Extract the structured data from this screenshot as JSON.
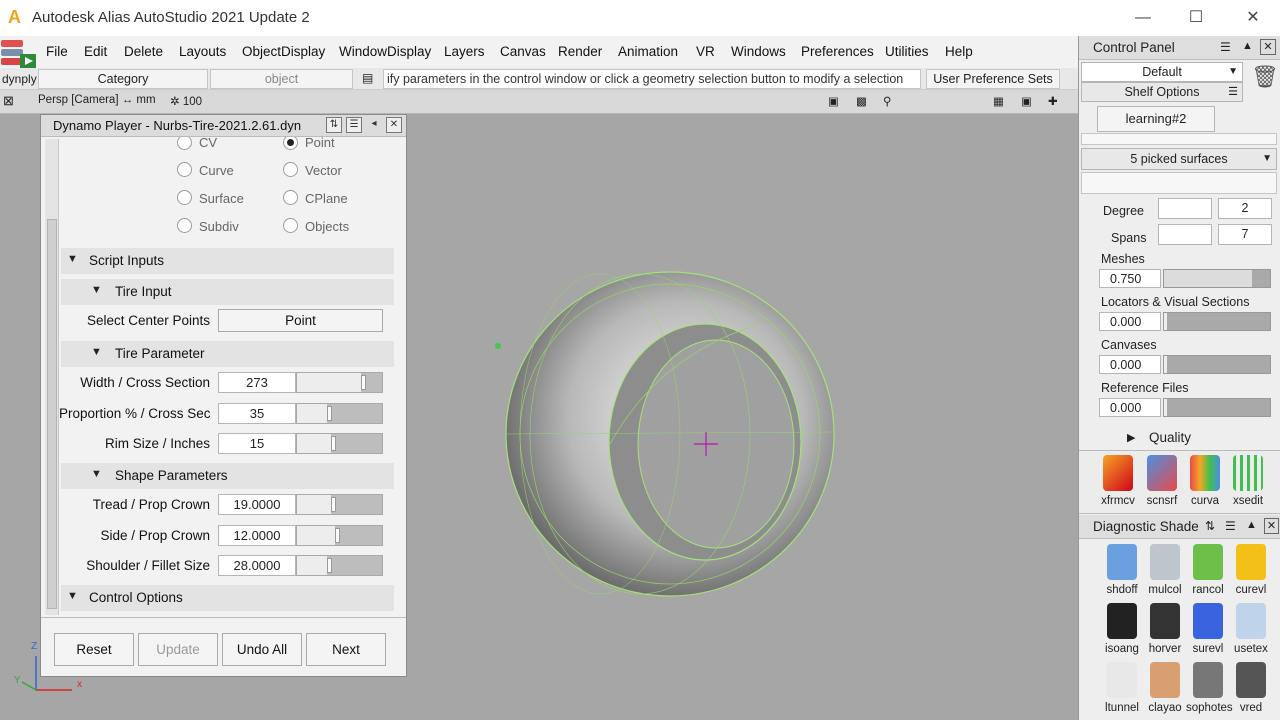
{
  "window": {
    "title": "Autodesk Alias AutoStudio 2021 Update 2",
    "app_icon_letter": "A"
  },
  "menubar": [
    "File",
    "Edit",
    "Delete",
    "Layouts",
    "ObjectDisplay",
    "WindowDisplay",
    "Layers",
    "Canvas",
    "Render",
    "Animation",
    "VR",
    "Windows",
    "Preferences",
    "Utilities",
    "Help"
  ],
  "toolbar2": {
    "dynply": "dynply",
    "category": "Category",
    "object": "object",
    "prompt": "ify parameters in the control window or click a geometry selection button to modify a selection",
    "user_pref": "User Preference Sets"
  },
  "viewport": {
    "camera": "Persp [Camera] ↔ mm",
    "zoom": "✲ 100",
    "axis_x": "x",
    "axis_y": "Y",
    "axis_z": "Z"
  },
  "dynamo": {
    "title": "Dynamo Player - Nurbs-Tire-2021.2.61.dyn",
    "radios": [
      {
        "label": "CV",
        "checked": false
      },
      {
        "label": "Point",
        "checked": true
      },
      {
        "label": "Curve",
        "checked": false
      },
      {
        "label": "Vector",
        "checked": false
      },
      {
        "label": "Surface",
        "checked": false
      },
      {
        "label": "CPlane",
        "checked": false
      },
      {
        "label": "Subdiv",
        "checked": false
      },
      {
        "label": "Objects",
        "checked": false
      }
    ],
    "script_inputs": "Script Inputs",
    "tire_input": "Tire Input",
    "select_center_label": "Select Center Points",
    "select_center_button": "Point",
    "tire_parameter": "Tire Parameter",
    "tire_params": [
      {
        "label": "Width / Cross Section",
        "value": "273",
        "level": 0.75
      },
      {
        "label": "Proportion % / Cross Section",
        "value": "35",
        "level": 0.35
      },
      {
        "label": "Rim Size / Inches",
        "value": "15",
        "level": 0.4
      }
    ],
    "shape_parameters": "Shape Parameters",
    "shape_params": [
      {
        "label": "Tread / Prop Crown",
        "value": "19.0000",
        "level": 0.4
      },
      {
        "label": "Side / Prop Crown",
        "value": "12.0000",
        "level": 0.45
      },
      {
        "label": "Shoulder / Fillet Size",
        "value": "28.0000",
        "level": 0.35
      }
    ],
    "control_options": "Control Options",
    "buttons": {
      "reset": "Reset",
      "update": "Update",
      "undo_all": "Undo All",
      "next": "Next"
    }
  },
  "control_panel": {
    "title": "Control Panel",
    "preset": "Default",
    "shelf_options": "Shelf Options",
    "tab": "learning#2",
    "selection": "5 picked surfaces",
    "degree_label": "Degree",
    "degree_value": "2",
    "spans_label": "Spans",
    "spans_value": "7",
    "meshes_label": "Meshes",
    "meshes_value": "0.750",
    "locators_label": "Locators & Visual Sections",
    "locators_value": "0.000",
    "canvases_label": "Canvases",
    "canvases_value": "0.000",
    "reference_label": "Reference Files",
    "reference_value": "0.000",
    "quality_label": "Quality",
    "tools": [
      "xfrmcv",
      "scnsrf",
      "curva",
      "xsedit"
    ]
  },
  "diagnostic_shade": {
    "title": "Diagnostic Shade",
    "items": [
      "shdoff",
      "mulcol",
      "rancol",
      "curevl",
      "isoang",
      "horver",
      "surevl",
      "usetex",
      "ltunnel",
      "clayao",
      "sophotes",
      "vred"
    ]
  }
}
